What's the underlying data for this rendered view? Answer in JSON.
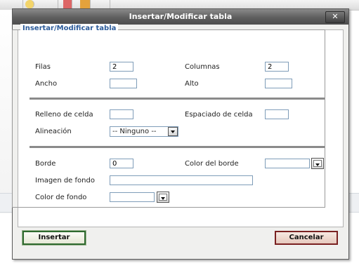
{
  "dialog": {
    "title": "Insertar/Modificar tabla",
    "close_label": "✕"
  },
  "fieldset": {
    "legend": "Insertar/Modificar tabla"
  },
  "fields": {
    "filas": {
      "label": "Filas",
      "value": "2"
    },
    "columnas": {
      "label": "Columnas",
      "value": "2"
    },
    "ancho": {
      "label": "Ancho",
      "value": ""
    },
    "alto": {
      "label": "Alto",
      "value": ""
    },
    "relleno": {
      "label": "Relleno de celda",
      "value": ""
    },
    "espaciado": {
      "label": "Espaciado de celda",
      "value": ""
    },
    "alineacion": {
      "label": "Alineación",
      "value": "-- Ninguno --"
    },
    "borde": {
      "label": "Borde",
      "value": "0"
    },
    "color_borde": {
      "label": "Color del borde",
      "value": ""
    },
    "imagen_fondo": {
      "label": "Imagen de fondo",
      "value": ""
    },
    "color_fondo": {
      "label": "Color de fondo",
      "value": ""
    }
  },
  "buttons": {
    "insert": "Insertar",
    "cancel": "Cancelar"
  },
  "colors": {
    "title_bg": "#5e5e5e",
    "legend_text": "#2b5b9a",
    "insert_border": "#2f6a2f",
    "cancel_border": "#7a2121"
  }
}
